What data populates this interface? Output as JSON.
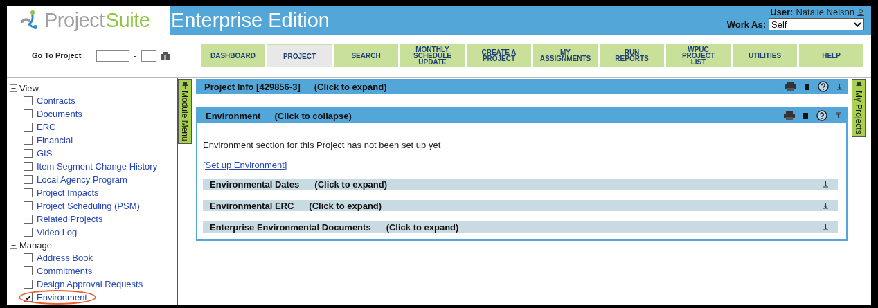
{
  "header": {
    "logo_gray": "Project",
    "logo_green": "Suite",
    "edition": "Enterprise Edition",
    "user_label": "User:",
    "user_name": "Natalie Nelson",
    "work_as_label": "Work As:",
    "work_as_value": "Self"
  },
  "goto": {
    "label": "Go To Project",
    "separator": "-"
  },
  "nav": [
    {
      "label": "DASHBOARD",
      "selected": false
    },
    {
      "label": "PROJECT",
      "selected": true
    },
    {
      "label": "SEARCH",
      "selected": false
    },
    {
      "label": "MONTHLY\nSCHEDULE\nUPDATE",
      "selected": false
    },
    {
      "label": "CREATE A\nPROJECT",
      "selected": false
    },
    {
      "label": "MY\nASSIGNMENTS",
      "selected": false
    },
    {
      "label": "RUN\nREPORTS",
      "selected": false
    },
    {
      "label": "WPUC\nPROJECT\nLIST",
      "selected": false
    },
    {
      "label": "UTILITIES",
      "selected": false
    },
    {
      "label": "HELP",
      "selected": false
    }
  ],
  "sidebar": {
    "groups": [
      {
        "label": "View",
        "expanded": true,
        "items": [
          {
            "label": "Contracts",
            "checked": false,
            "circled": false
          },
          {
            "label": "Documents",
            "checked": false,
            "circled": false
          },
          {
            "label": "ERC",
            "checked": false,
            "circled": false
          },
          {
            "label": "Financial",
            "checked": false,
            "circled": false
          },
          {
            "label": "GIS",
            "checked": false,
            "circled": false
          },
          {
            "label": "Item Segment Change History",
            "checked": false,
            "circled": false
          },
          {
            "label": "Local Agency Program",
            "checked": false,
            "circled": false
          },
          {
            "label": "Project Impacts",
            "checked": false,
            "circled": false
          },
          {
            "label": "Project Scheduling (PSM)",
            "checked": false,
            "circled": false
          },
          {
            "label": "Related Projects",
            "checked": false,
            "circled": false
          },
          {
            "label": "Video Log",
            "checked": false,
            "circled": false
          }
        ]
      },
      {
        "label": "Manage",
        "expanded": true,
        "items": [
          {
            "label": "Address Book",
            "checked": false,
            "circled": false
          },
          {
            "label": "Commitments",
            "checked": false,
            "circled": false
          },
          {
            "label": "Design Approval Requests",
            "checked": false,
            "circled": false
          },
          {
            "label": "Environment",
            "checked": true,
            "circled": true
          }
        ]
      }
    ]
  },
  "side_tabs": {
    "left": "Module Menu",
    "right": "My Projects"
  },
  "panels": [
    {
      "title": "Project Info [429856-3]",
      "action": "(Click to expand)",
      "expanded": false
    },
    {
      "title": "Environment",
      "action": "(Click to collapse)",
      "expanded": true,
      "message": "Environment section for this Project has not been set up yet",
      "link": "[Set up Environment]",
      "subsections": [
        {
          "title": "Environmental Dates",
          "action": "(Click to expand)",
          "expanded": false
        },
        {
          "title": "Environmental ERC",
          "action": "(Click to expand)",
          "expanded": false
        },
        {
          "title": "Enterprise Environmental Documents",
          "action": "(Click to expand)",
          "expanded": false
        }
      ]
    }
  ]
}
